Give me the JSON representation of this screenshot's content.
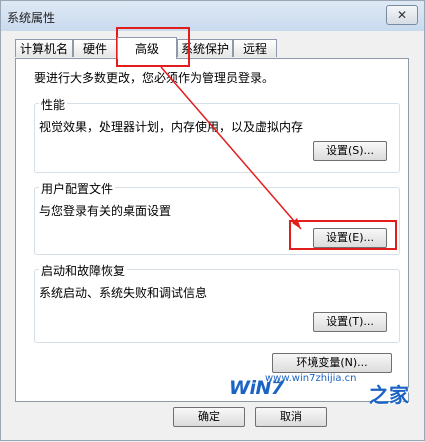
{
  "window": {
    "title": "系统属性",
    "close_label": "✕"
  },
  "tabs": [
    {
      "label": "计算机名"
    },
    {
      "label": "硬件"
    },
    {
      "label": "高级"
    },
    {
      "label": "系统保护"
    },
    {
      "label": "远程"
    }
  ],
  "panel": {
    "notice": "要进行大多数更改，您必须作为管理员登录。",
    "performance": {
      "title": "性能",
      "description": "视觉效果，处理器计划，内存使用，以及虚拟内存",
      "button": "设置(S)..."
    },
    "user_profiles": {
      "title": "用户配置文件",
      "description": "与您登录有关的桌面设置",
      "button": "设置(E)..."
    },
    "startup_recovery": {
      "title": "启动和故障恢复",
      "description": "系统启动、系统失败和调试信息",
      "button": "设置(T)..."
    },
    "env_button": "环境变量(N)..."
  },
  "footer": {
    "ok": "确定",
    "cancel": "取消"
  },
  "watermark": {
    "brand": "WiN7",
    "url": "www.win7zhijia.cn",
    "suffix": "之家"
  },
  "colors": {
    "annotation": "#e31c1c",
    "watermark": "#1b63c4"
  }
}
